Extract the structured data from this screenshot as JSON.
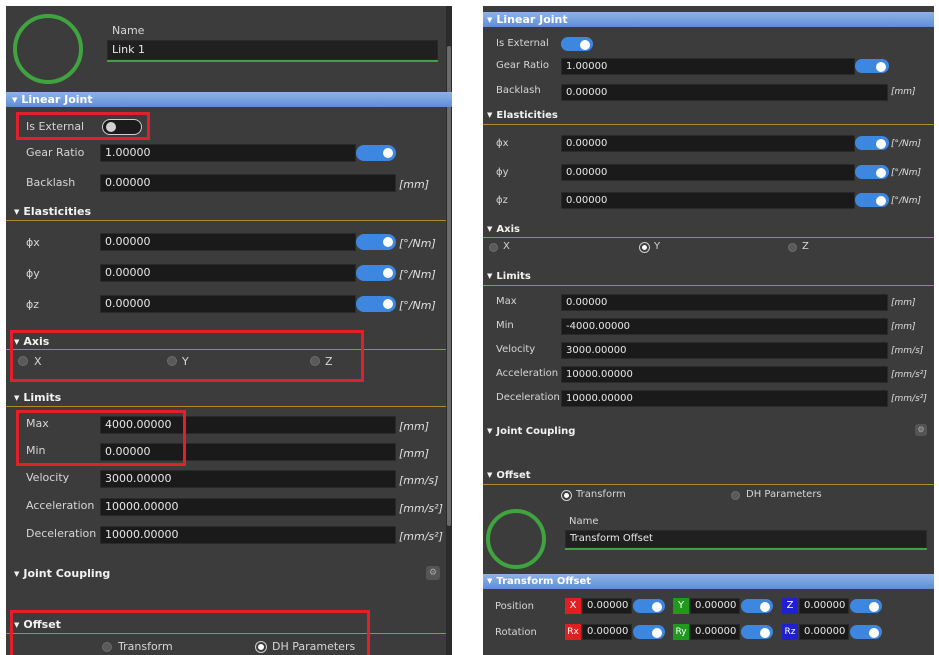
{
  "left": {
    "name_label": "Name",
    "name_value": "Link 1",
    "linear_joint_header": "Linear Joint",
    "is_external_label": "Is External",
    "gear_ratio_label": "Gear Ratio",
    "gear_ratio_value": "1.00000",
    "backlash_label": "Backlash",
    "backlash_value": "0.00000",
    "backlash_unit": "[mm]",
    "elasticities_header": "Elasticities",
    "elasticities": [
      {
        "label": "ϕx",
        "value": "0.00000",
        "unit": "[°/Nm]"
      },
      {
        "label": "ϕy",
        "value": "0.00000",
        "unit": "[°/Nm]"
      },
      {
        "label": "ϕz",
        "value": "0.00000",
        "unit": "[°/Nm]"
      }
    ],
    "axis_header": "Axis",
    "axis_options": [
      "X",
      "Y",
      "Z"
    ],
    "limits_header": "Limits",
    "limits": [
      {
        "label": "Max",
        "value": "4000.00000",
        "unit": "[mm]"
      },
      {
        "label": "Min",
        "value": "0.00000",
        "unit": "[mm]"
      },
      {
        "label": "Velocity",
        "value": "3000.00000",
        "unit": "[mm/s]"
      },
      {
        "label": "Acceleration",
        "value": "10000.00000",
        "unit": "[mm/s²]"
      },
      {
        "label": "Deceleration",
        "value": "10000.00000",
        "unit": "[mm/s²]"
      }
    ],
    "joint_coupling_header": "Joint Coupling",
    "offset_header": "Offset",
    "offset_options": [
      "Transform",
      "DH Parameters"
    ],
    "is_external_on": false
  },
  "right": {
    "linear_joint_header": "Linear Joint",
    "is_external_label": "Is External",
    "gear_ratio_label": "Gear Ratio",
    "gear_ratio_value": "1.00000",
    "backlash_label": "Backlash",
    "backlash_value": "0.00000",
    "backlash_unit": "[mm]",
    "elasticities_header": "Elasticities",
    "elasticities": [
      {
        "label": "ϕx",
        "value": "0.00000",
        "unit": "[°/Nm]"
      },
      {
        "label": "ϕy",
        "value": "0.00000",
        "unit": "[°/Nm]"
      },
      {
        "label": "ϕz",
        "value": "0.00000",
        "unit": "[°/Nm]"
      }
    ],
    "axis_header": "Axis",
    "axis_options": [
      "X",
      "Y",
      "Z"
    ],
    "limits_header": "Limits",
    "limits": [
      {
        "label": "Max",
        "value": "0.00000",
        "unit": "[mm]"
      },
      {
        "label": "Min",
        "value": "-4000.00000",
        "unit": "[mm]"
      },
      {
        "label": "Velocity",
        "value": "3000.00000",
        "unit": "[mm/s]"
      },
      {
        "label": "Acceleration",
        "value": "10000.00000",
        "unit": "[mm/s²]"
      },
      {
        "label": "Deceleration",
        "value": "10000.00000",
        "unit": "[mm/s²]"
      }
    ],
    "joint_coupling_header": "Joint Coupling",
    "offset_header": "Offset",
    "offset_options": [
      "Transform",
      "DH Parameters"
    ],
    "name_label": "Name",
    "name_value": "Transform Offset",
    "transform_offset_header": "Transform Offset",
    "position_label": "Position",
    "rotation_label": "Rotation",
    "position": [
      {
        "axis": "X",
        "value": "0.00000",
        "color": "#e02020"
      },
      {
        "axis": "Y",
        "value": "0.00000",
        "color": "#1f9a1f"
      },
      {
        "axis": "Z",
        "value": "0.00000",
        "color": "#2020d0"
      }
    ],
    "rotation": [
      {
        "axis": "Rx",
        "value": "0.00000",
        "color": "#e02020"
      },
      {
        "axis": "Ry",
        "value": "0.00000",
        "color": "#1f9a1f"
      },
      {
        "axis": "Rz",
        "value": "0.00000",
        "color": "#2020d0"
      }
    ],
    "is_external_on": true
  },
  "colors": {
    "panel_bg": "#3c3c3c",
    "accent_blue": "#3e87e0",
    "header_blue": "#6f9be0",
    "highlight_red": "#e0202a",
    "link_green": "#3fa43f"
  }
}
